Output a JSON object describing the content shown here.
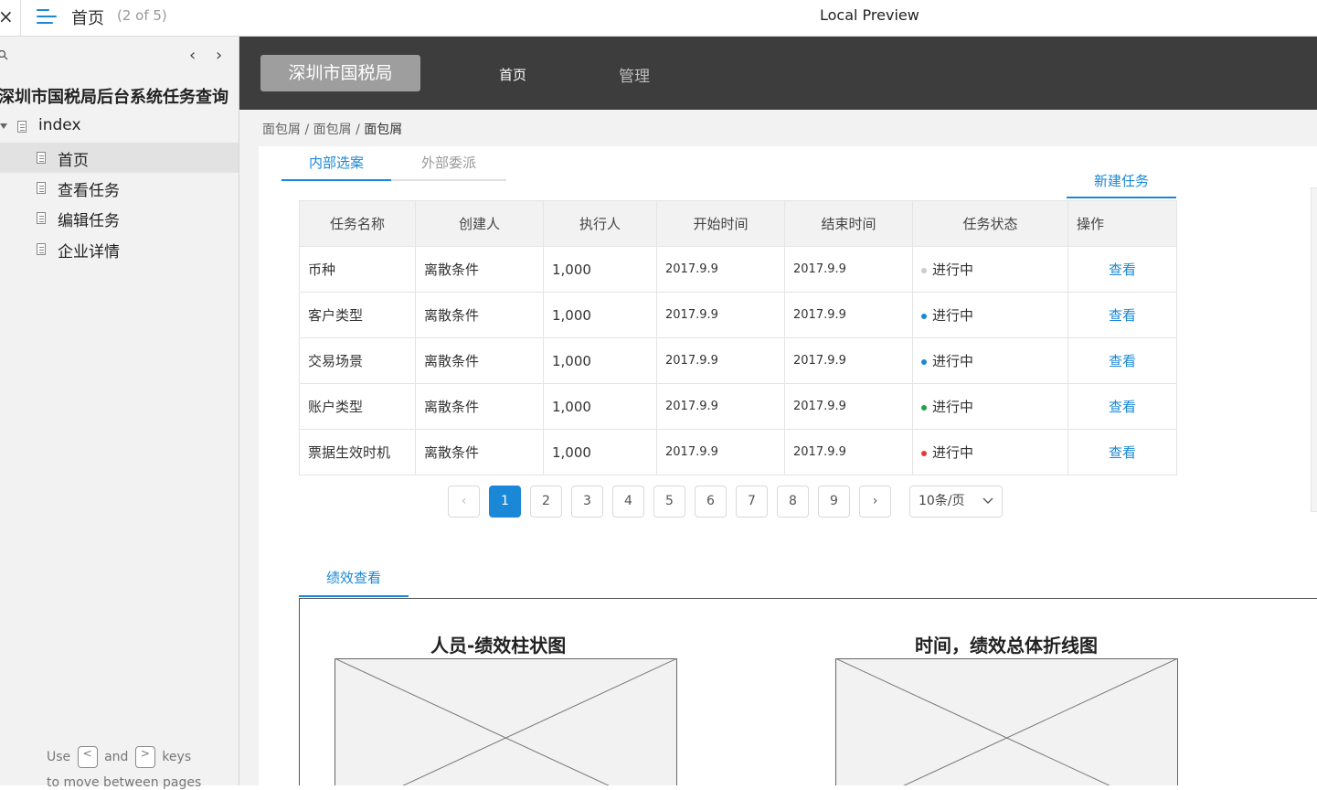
{
  "topbar": {
    "close": "×",
    "page_name": "首页",
    "page_count": "(2 of 5)",
    "preview_title": "Local Preview"
  },
  "sidebar": {
    "project_title": "深圳市国税局后台系统任务查询",
    "root": "index",
    "pages": [
      "首页",
      "查看任务",
      "编辑任务",
      "企业详情"
    ],
    "active_page": "首页",
    "hint": {
      "use": "Use",
      "and": "and",
      "keys": "keys",
      "line2": "to move between pages",
      "key_prev": "<",
      "key_next": ">"
    }
  },
  "header": {
    "brand": "深圳市国税局",
    "nav": [
      "首页",
      "管理"
    ]
  },
  "breadcrumb": [
    "面包屑",
    "面包屑",
    "面包屑"
  ],
  "tabs": [
    "内部选案",
    "外部委派"
  ],
  "new_task_label": "新建任务",
  "table": {
    "columns": [
      "任务名称",
      "创建人",
      "执行人",
      "开始时间",
      "结束时间",
      "任务状态",
      "操作"
    ],
    "rows": [
      {
        "name": "币种",
        "creator": "离散条件",
        "executor": "1,000",
        "start": "2017.9.9",
        "end": "2017.9.9",
        "status": "进行中",
        "status_color": "#cccccc",
        "action": "查看"
      },
      {
        "name": "客户类型",
        "creator": "离散条件",
        "executor": "1,000",
        "start": "2017.9.9",
        "end": "2017.9.9",
        "status": "进行中",
        "status_color": "#1a88d6",
        "action": "查看"
      },
      {
        "name": "交易场景",
        "creator": "离散条件",
        "executor": "1,000",
        "start": "2017.9.9",
        "end": "2017.9.9",
        "status": "进行中",
        "status_color": "#1a88d6",
        "action": "查看"
      },
      {
        "name": "账户类型",
        "creator": "离散条件",
        "executor": "1,000",
        "start": "2017.9.9",
        "end": "2017.9.9",
        "status": "进行中",
        "status_color": "#1ba548",
        "action": "查看"
      },
      {
        "name": "票据生效时机",
        "creator": "离散条件",
        "executor": "1,000",
        "start": "2017.9.9",
        "end": "2017.9.9",
        "status": "进行中",
        "status_color": "#e53935",
        "action": "查看"
      }
    ]
  },
  "pagination": {
    "prev": "‹",
    "next": "›",
    "pages": [
      "1",
      "2",
      "3",
      "4",
      "5",
      "6",
      "7",
      "8",
      "9"
    ],
    "current": "1",
    "page_size": "10条/页"
  },
  "performance": {
    "tab": "绩效查看",
    "charts": [
      "人员-绩效柱状图",
      "时间，绩效总体折线图"
    ]
  },
  "colors": {
    "accent": "#1a88d6",
    "header_bg": "#3d3d3d"
  }
}
